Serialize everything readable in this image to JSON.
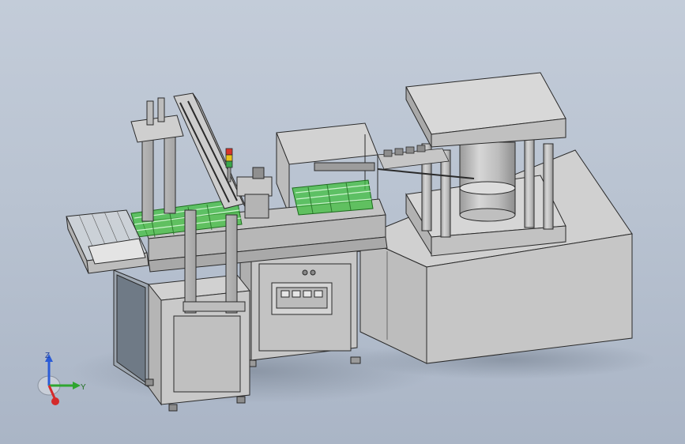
{
  "viewport": {
    "background_top": "#c3ccd9",
    "background_bottom": "#aab5c6"
  },
  "model": {
    "body_color": "#c9c9c9",
    "edge_color": "#2a2a2a",
    "conveyor_color": "#3fbf3f",
    "signal_tower_colors": [
      "#d8342a",
      "#e8c21c",
      "#3aa64a"
    ]
  },
  "triad": {
    "z_label": "Z",
    "y_label": "Y",
    "z_color": "#2a5bd7",
    "y_color": "#2fa52f",
    "x_color": "#d42a2a"
  }
}
